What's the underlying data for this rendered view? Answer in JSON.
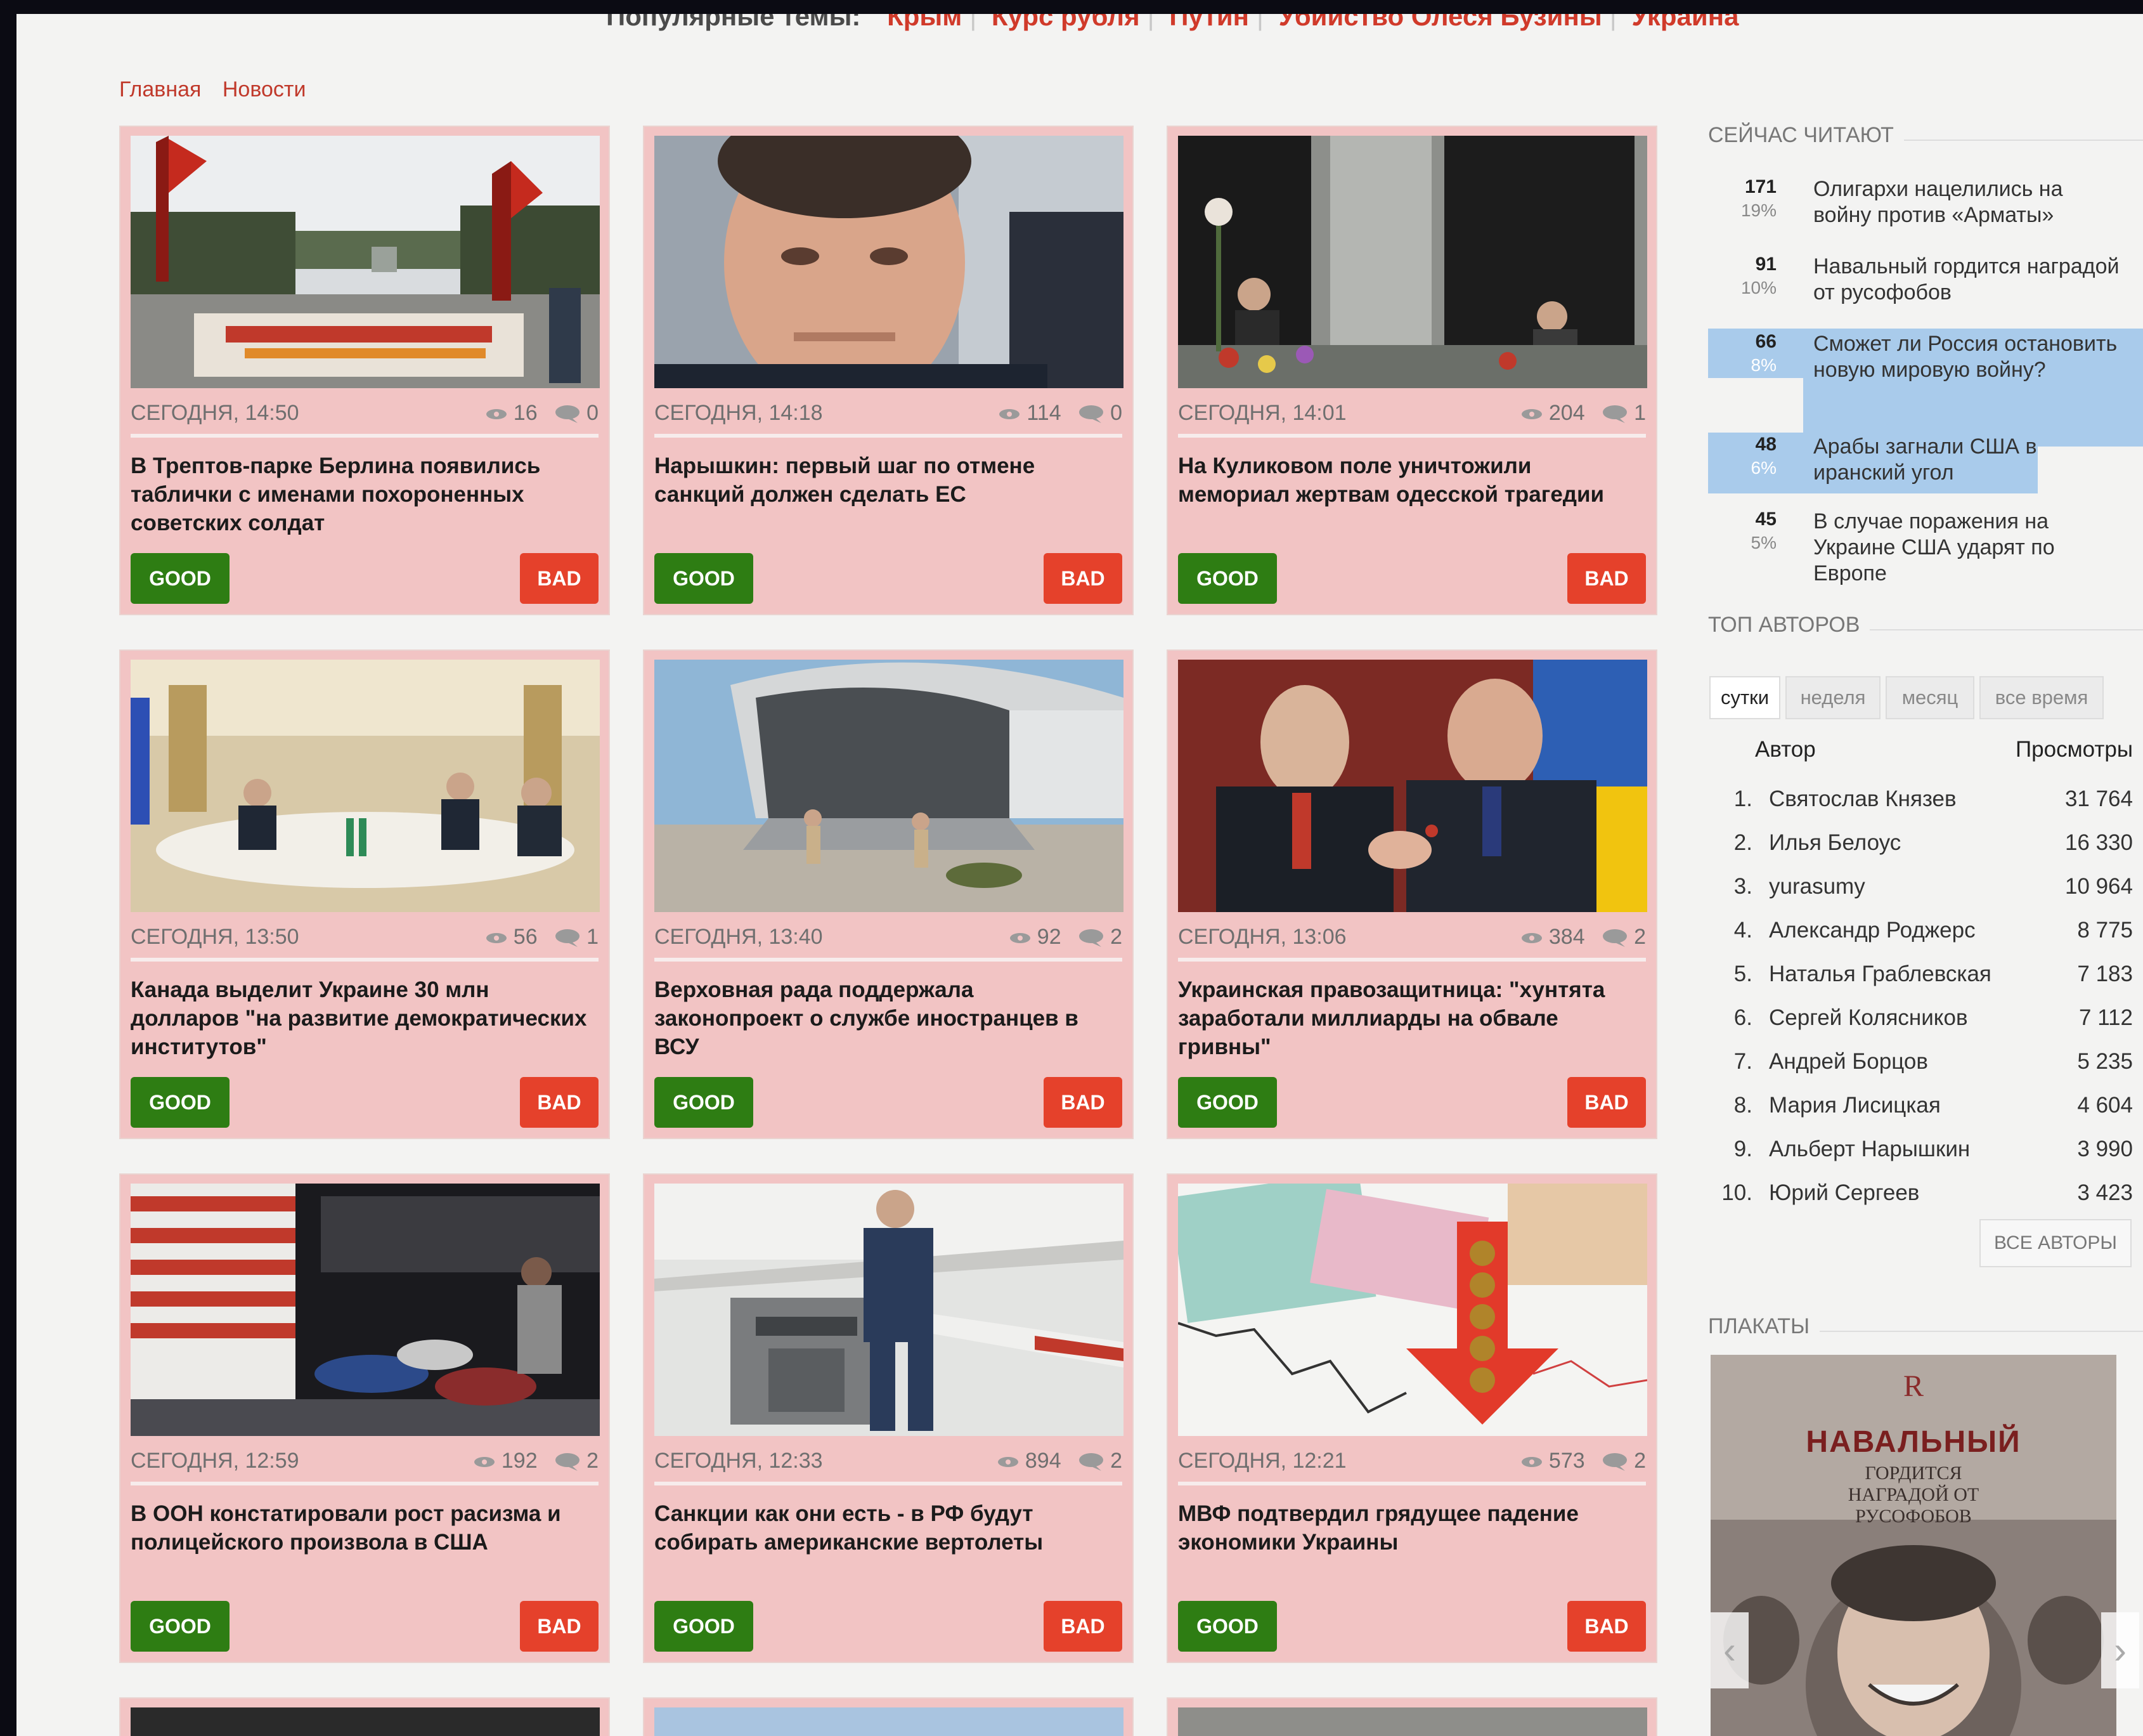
{
  "popular": {
    "label": "Популярные темы:",
    "topics": [
      "Крым",
      "Курс рубля",
      "Путин",
      "Убийство Олеся Бузины",
      "Украина"
    ]
  },
  "breadcrumbs": [
    "Главная",
    "Новости"
  ],
  "buttons": {
    "good": "GOOD",
    "bad": "BAD"
  },
  "cards": [
    {
      "date": "СЕГОДНЯ, 14:50",
      "views": "16",
      "comments": "0",
      "title": "В Трептов-парке Берлина появились таблички с именами похороненных советских солдат"
    },
    {
      "date": "СЕГОДНЯ, 14:18",
      "views": "114",
      "comments": "0",
      "title": "Нарышкин: первый шаг по отмене санкций должен сделать ЕС"
    },
    {
      "date": "СЕГОДНЯ, 14:01",
      "views": "204",
      "comments": "1",
      "title": "На Куликовом поле уничтожили мемориал жертвам одесской трагедии"
    },
    {
      "date": "СЕГОДНЯ, 13:50",
      "views": "56",
      "comments": "1",
      "title": "Канада выделит Украине 30 млн долларов \"на развитие демократических институтов\""
    },
    {
      "date": "СЕГОДНЯ, 13:40",
      "views": "92",
      "comments": "2",
      "title": "Верховная рада поддержала законопроект о службе иностранцев в ВСУ"
    },
    {
      "date": "СЕГОДНЯ, 13:06",
      "views": "384",
      "comments": "2",
      "title": "Украинская правозащитница: \"хунтята заработали миллиарды на обвале гривны\""
    },
    {
      "date": "СЕГОДНЯ, 12:59",
      "views": "192",
      "comments": "2",
      "title": "В ООН констатировали рост расизма и полицейского произвола в США"
    },
    {
      "date": "СЕГОДНЯ, 12:33",
      "views": "894",
      "comments": "2",
      "title": "Санкции как они есть - в РФ будут собирать американские вертолеты"
    },
    {
      "date": "СЕГОДНЯ, 12:21",
      "views": "573",
      "comments": "2",
      "title": "МВФ подтвердил грядущее падение экономики Украины"
    }
  ],
  "sidebar": {
    "now_reading": {
      "title": "СЕЙЧАС ЧИТАЮТ",
      "items": [
        {
          "count": "171",
          "percent": "19%",
          "text": "Олигархи нацелились на войну против «Арматы»"
        },
        {
          "count": "91",
          "percent": "10%",
          "text": "Навальный гордится наградой от русофобов"
        },
        {
          "count": "66",
          "percent": "8%",
          "text": "Сможет ли Россия остановить новую мировую войну?"
        },
        {
          "count": "48",
          "percent": "6%",
          "text": "Арабы загнали США в иранский угол"
        },
        {
          "count": "45",
          "percent": "5%",
          "text": "В случае поражения на Украине США ударят по Европе"
        }
      ]
    },
    "top_authors": {
      "title": "ТОП АВТОРОВ",
      "tabs": [
        "сутки",
        "неделя",
        "месяц",
        "все время"
      ],
      "active_tab": "сутки",
      "col_author": "Автор",
      "col_views": "Просмотры",
      "rows": [
        {
          "rank": "1.",
          "name": "Святослав Князев",
          "views": "31 764"
        },
        {
          "rank": "2.",
          "name": "Илья Белоус",
          "views": "16 330"
        },
        {
          "rank": "3.",
          "name": "yurasumy",
          "views": "10 964"
        },
        {
          "rank": "4.",
          "name": "Александр Роджерс",
          "views": "8 775"
        },
        {
          "rank": "5.",
          "name": "Наталья Граблевская",
          "views": "7 183"
        },
        {
          "rank": "6.",
          "name": "Сергей Колясников",
          "views": "7 112"
        },
        {
          "rank": "7.",
          "name": "Андрей Борцов",
          "views": "5 235"
        },
        {
          "rank": "8.",
          "name": "Мария Лисицкая",
          "views": "4 604"
        },
        {
          "rank": "9.",
          "name": "Альберт Нарышкин",
          "views": "3 990"
        },
        {
          "rank": "10.",
          "name": "Юрий Сергеев",
          "views": "3 423"
        }
      ],
      "all_authors_label": "ВСЕ АВТОРЫ"
    },
    "posters": {
      "title": "ПЛАКАТЫ",
      "poster_logo": "R",
      "poster_heading": "НАВАЛЬНЫЙ",
      "poster_sub": "ГОРДИТСЯ НАГРАДОЙ ОТ РУСОФОБОВ"
    }
  }
}
